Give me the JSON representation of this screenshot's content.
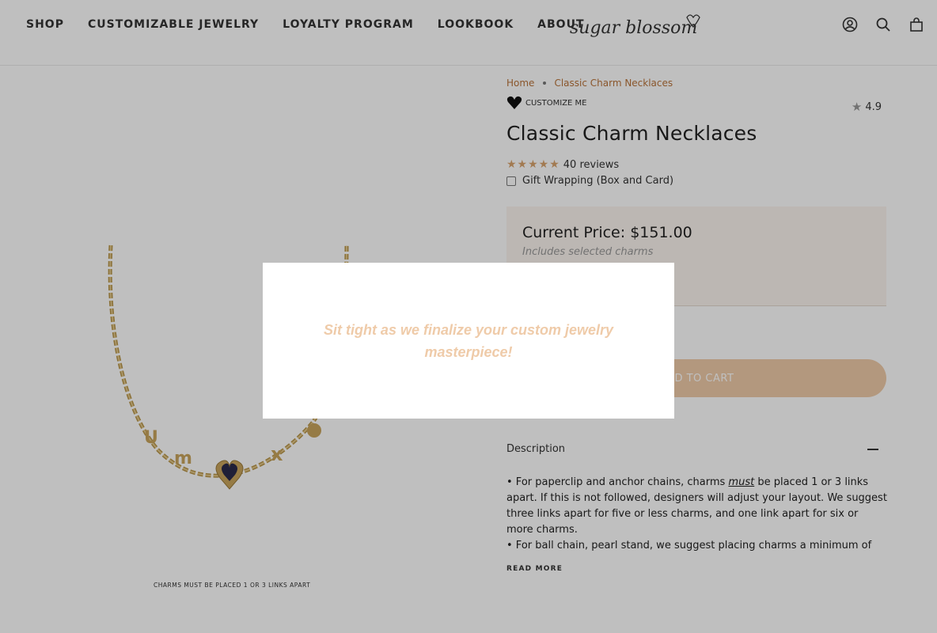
{
  "header": {
    "nav": [
      "SHOP",
      "CUSTOMIZABLE JEWELRY",
      "LOYALTY PROGRAM",
      "LOOKBOOK",
      "ABOUT"
    ],
    "logo_text": "sugar blossom",
    "icons": [
      "account-icon",
      "search-icon",
      "cart-icon"
    ]
  },
  "gallery": {
    "caption": "CHARMS MUST BE PLACED 1 OR 3 LINKS APART"
  },
  "product": {
    "breadcrumb": [
      "Home",
      "Classic Charm Necklaces"
    ],
    "badge": "CUSTOMIZE ME",
    "rating": "4.9",
    "title": "Classic Charm Necklaces",
    "stars": "★★★★★",
    "reviews": "40 reviews",
    "gift_wrap_label": "Gift Wrapping (Box and Card)",
    "price_label": "Current Price: $151.00",
    "price_note": "Includes selected charms",
    "add_to_cart": "ADD TO CART",
    "description_label": "Description",
    "description": {
      "line1_pre": "• For paperclip and anchor chains, charms ",
      "line1_em": "must",
      "line1_post": " be placed 1 or 3 links apart. If this is not followed, designers will adjust your layout. We suggest three links apart for five or less charms, and one link apart for six or more charms.",
      "line2": "• For ball chain, pearl stand, we suggest placing charms a minimum of"
    },
    "read_more": "READ MORE"
  },
  "modal": {
    "message": "Sit tight as we finalize your custom jewelry masterpiece!"
  },
  "colors": {
    "accent": "#efcba9",
    "link": "#b9733a",
    "star": "#d9a36c",
    "price_bg": "#fbf4ef"
  }
}
